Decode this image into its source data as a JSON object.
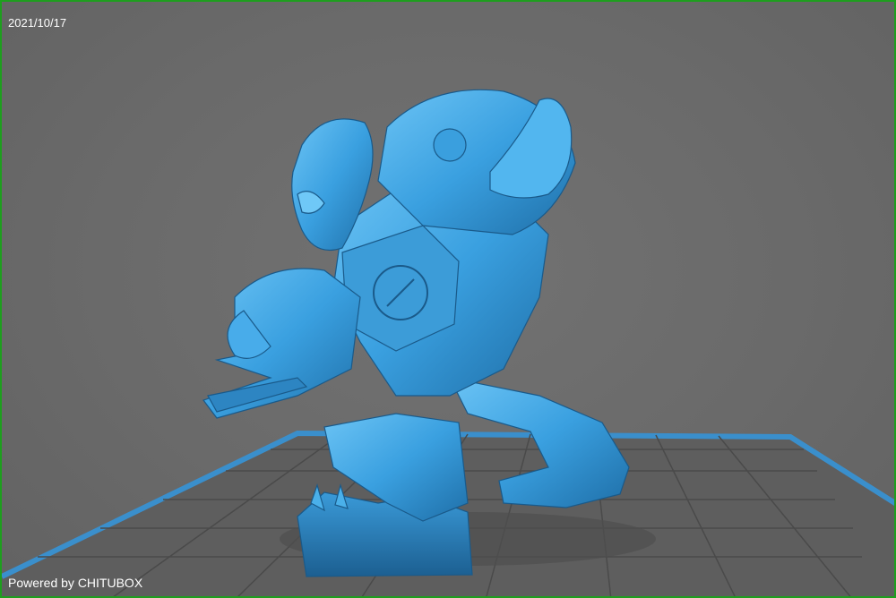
{
  "viewer": {
    "date_label": "2021/10/17",
    "watermark": "Powered by CHITUBOX",
    "frame_color": "#1e9e1e",
    "background_color": "#6b6b6b",
    "model_color": "#3aa0e0",
    "build_plate_color": "#3a8fcc"
  }
}
